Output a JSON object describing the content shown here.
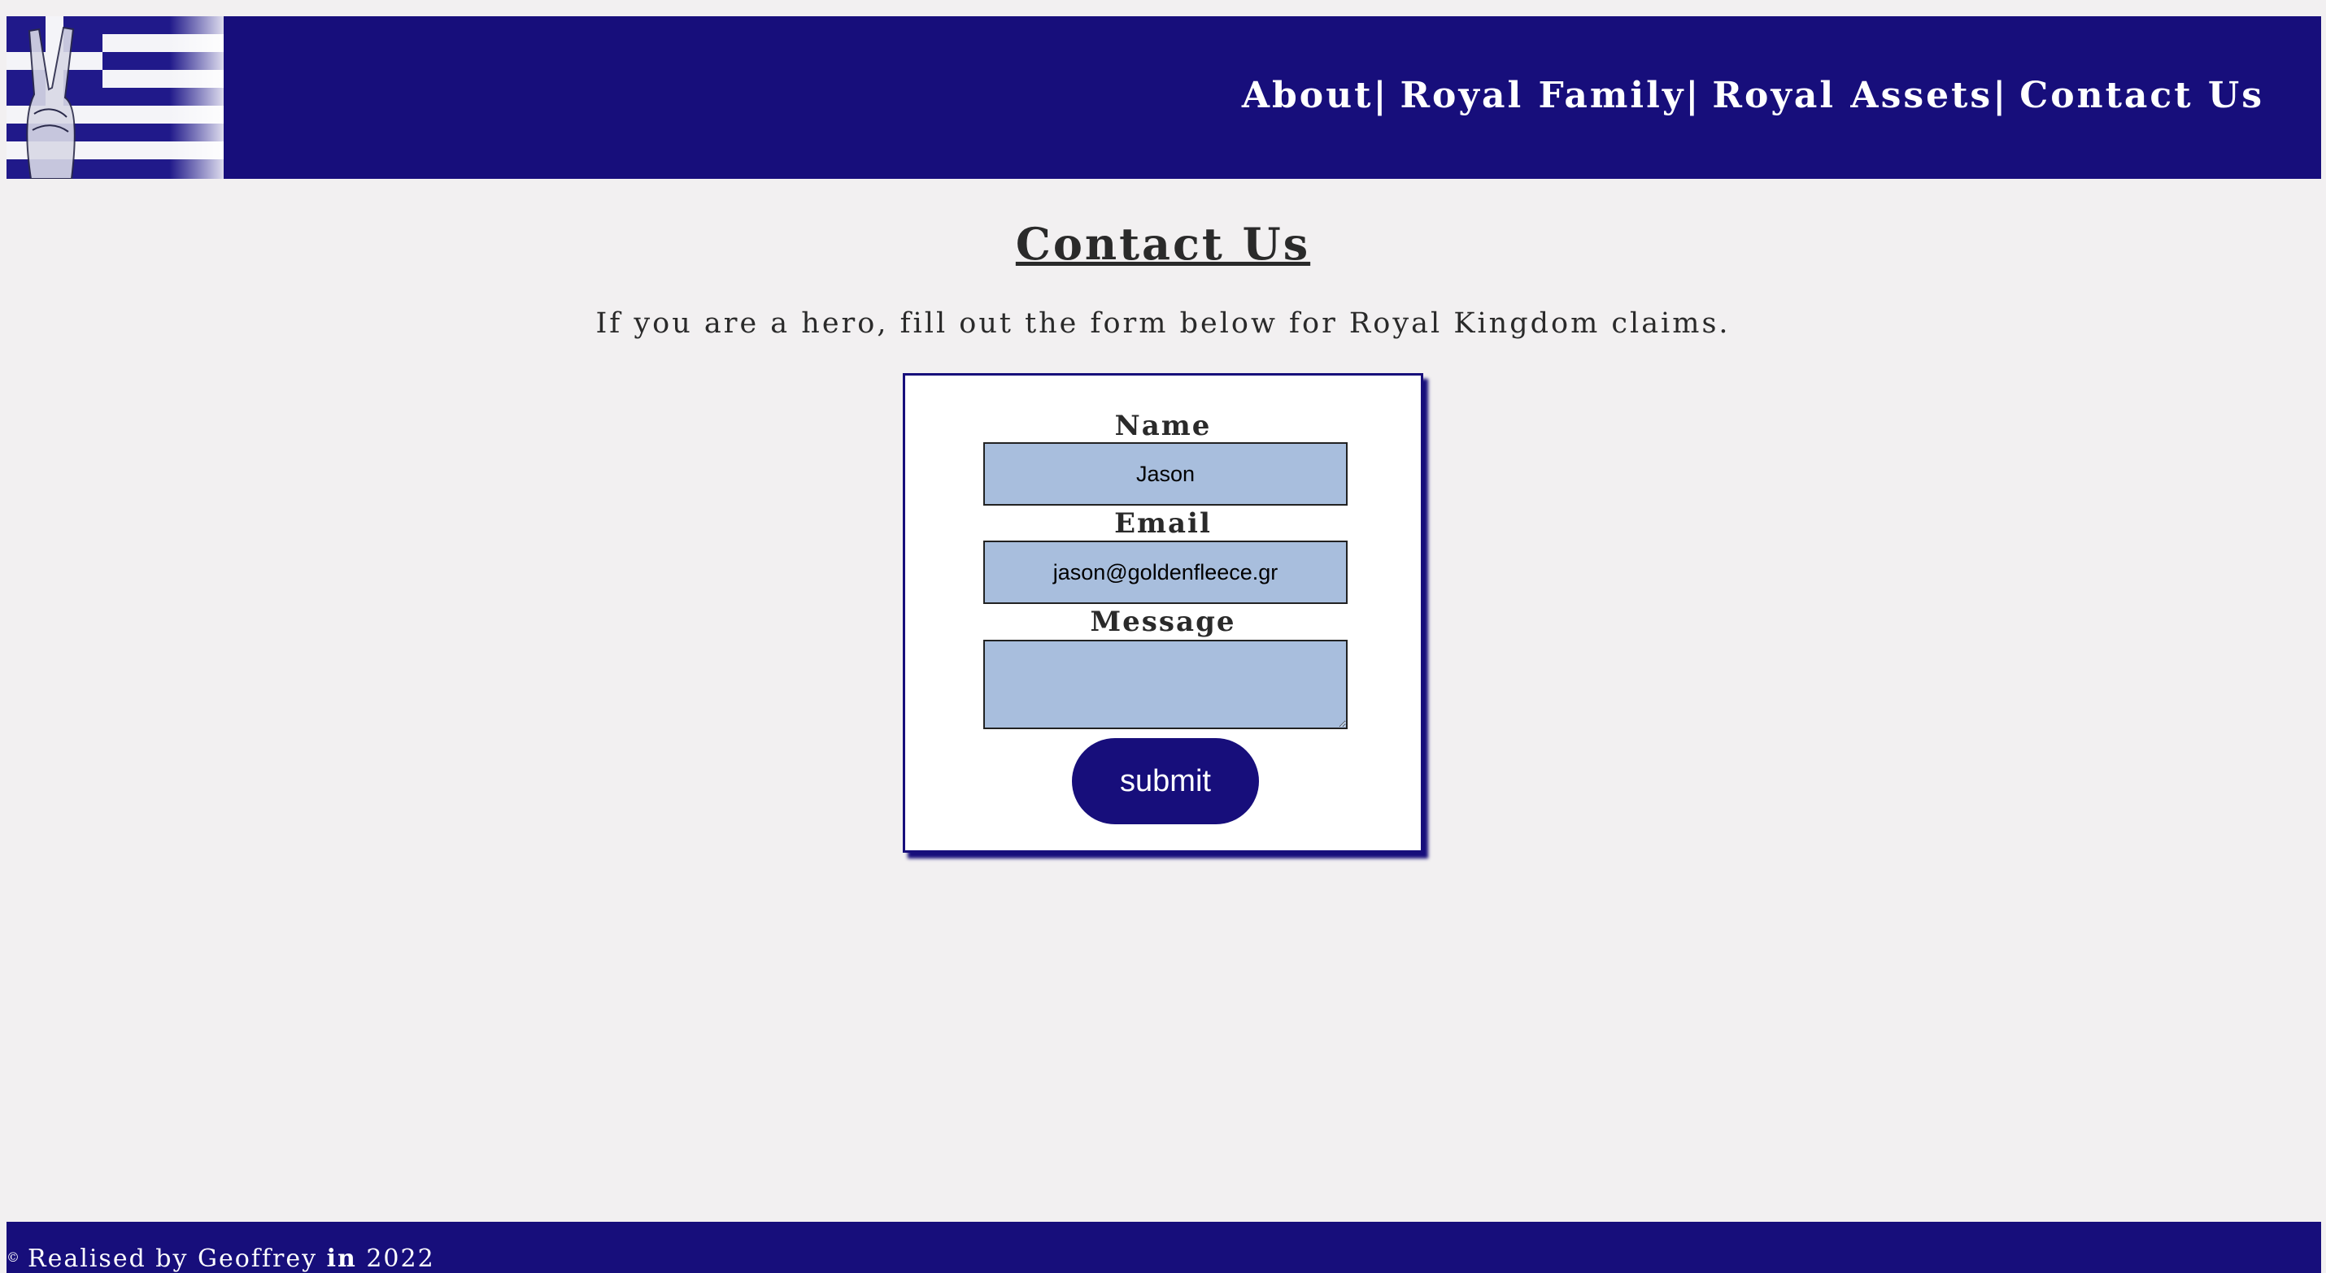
{
  "header": {
    "nav": [
      {
        "label": "About",
        "separator": "|"
      },
      {
        "label": "Royal Family",
        "separator": "|"
      },
      {
        "label": "Royal Assets",
        "separator": "|"
      },
      {
        "label": "Contact Us"
      }
    ]
  },
  "main": {
    "title": "Contact Us",
    "intro": "If you are a hero, fill out the form below for Royal Kingdom claims.",
    "form": {
      "name_label": "Name",
      "name_value": "Jason",
      "email_label": "Email",
      "email_value": "jason@goldenfleece.gr",
      "message_label": "Message",
      "message_value": "",
      "submit_label": "submit"
    }
  },
  "footer": {
    "copyright_symbol": "©",
    "text_prefix": "Realised by Geoffrey",
    "text_in": "in",
    "year": "2022"
  },
  "colors": {
    "brand_navy": "#170e7b",
    "page_background": "#f2f0f1",
    "input_background": "#a8bedd"
  }
}
